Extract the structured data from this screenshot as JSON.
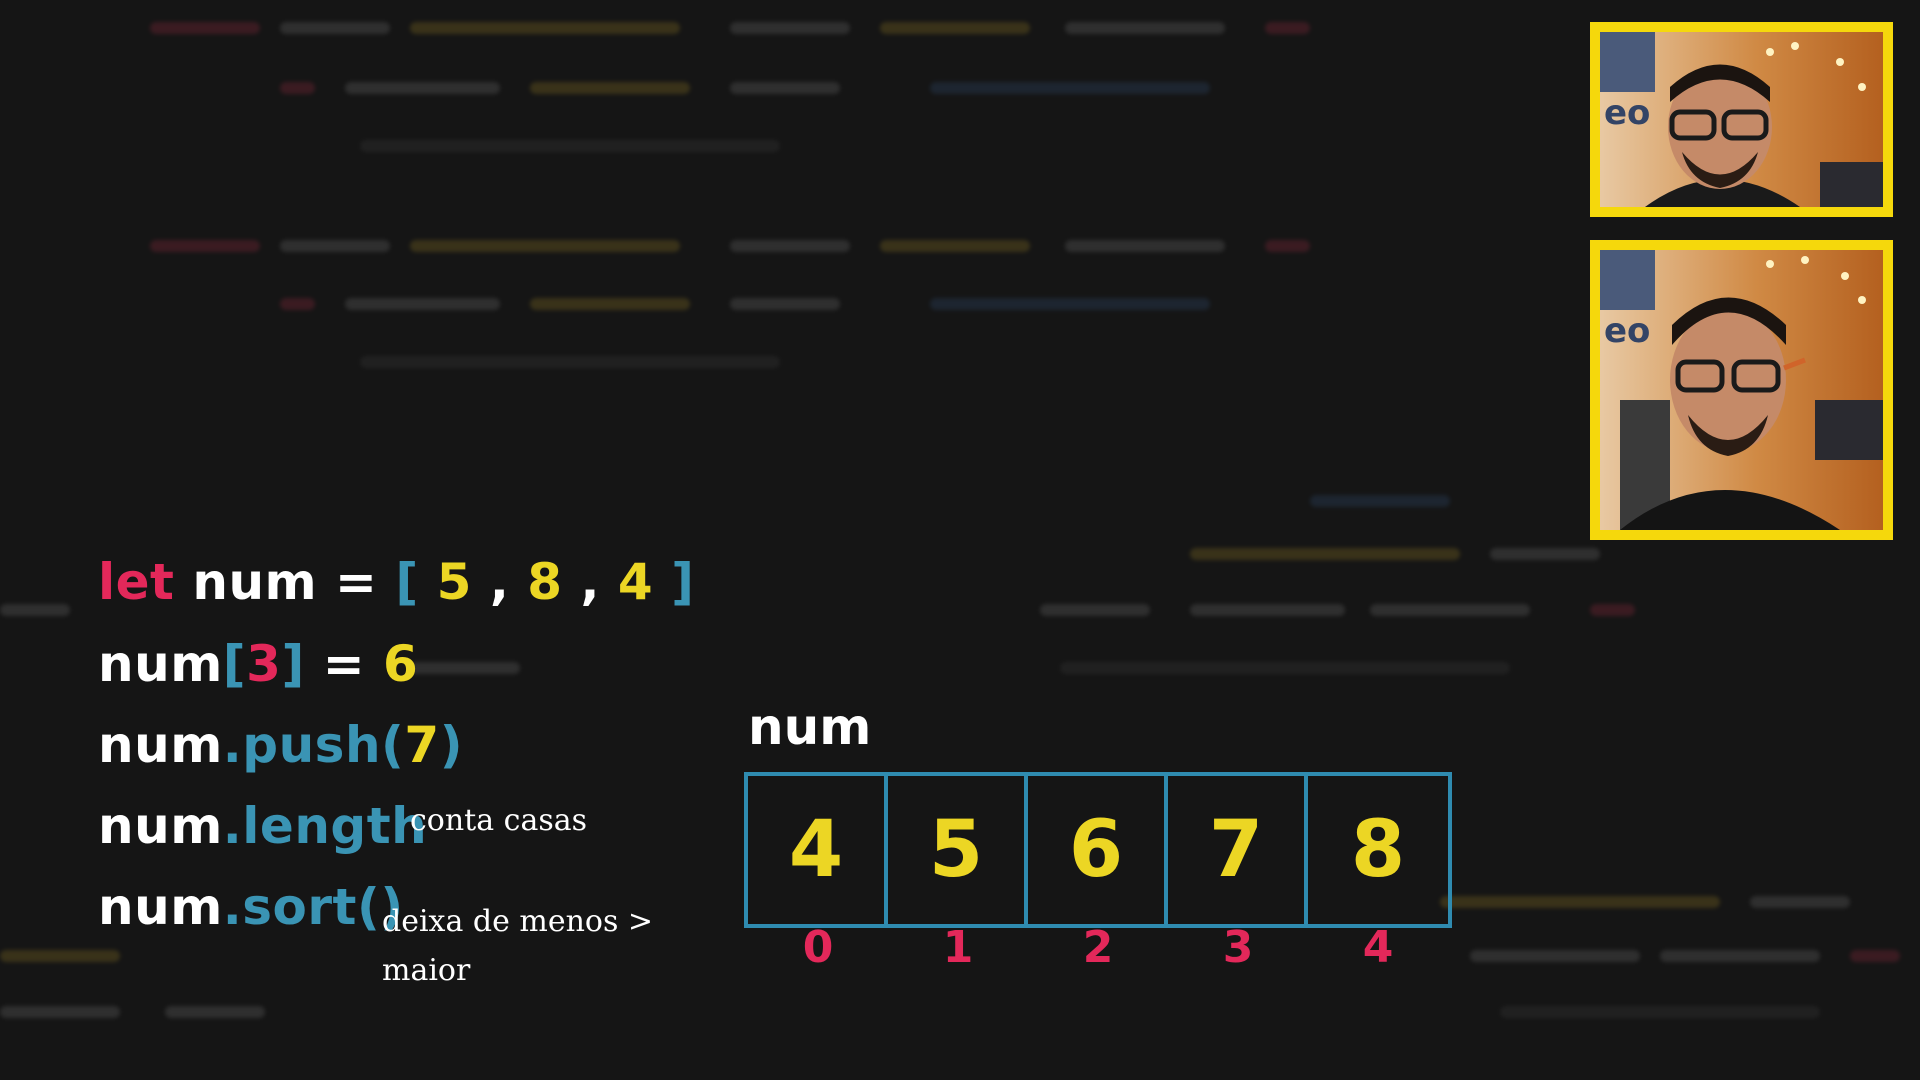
{
  "code": {
    "line1": {
      "kw": "let",
      "name": " num = ",
      "open": "[ ",
      "v1": "5",
      "sep1": " , ",
      "v2": "8",
      "sep2": " , ",
      "v3": "4",
      "close": " ]"
    },
    "line2": {
      "name": "num",
      "open": "[",
      "idx": "3",
      "close": "]",
      "eq": " = ",
      "val": "6"
    },
    "line3": {
      "name": "num",
      "method": ".push(",
      "arg": "7",
      "close": ")"
    },
    "line4": {
      "name": "num",
      "method": ".length",
      "comment": "conta casas"
    },
    "line5": {
      "name": "num",
      "method": ".sort()",
      "comment_l1": "deixa de menos >",
      "comment_l2": "maior"
    }
  },
  "array": {
    "name": "num",
    "values": [
      "4",
      "5",
      "6",
      "7",
      "8"
    ],
    "indexes": [
      "0",
      "1",
      "2",
      "3",
      "4"
    ]
  },
  "colors": {
    "keyword": "#e3285a",
    "bracket_method": "#3a94b4",
    "number": "#ecd624",
    "frame": "#f5d80c",
    "background": "#151515"
  },
  "webcams": [
    "presenter-camera-top",
    "presenter-camera-bottom"
  ]
}
